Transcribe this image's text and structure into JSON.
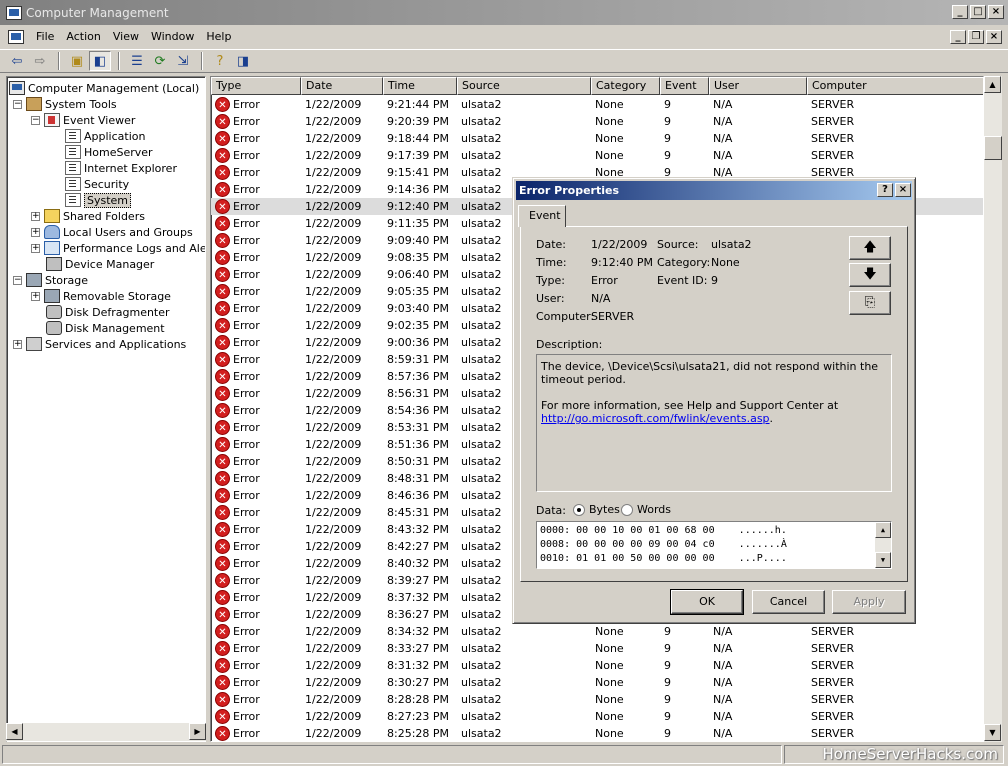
{
  "window": {
    "title": "Computer Management"
  },
  "menu": {
    "items": [
      "File",
      "Action",
      "View",
      "Window",
      "Help"
    ]
  },
  "tree": {
    "root": "Computer Management (Local)",
    "system_tools": "System Tools",
    "event_viewer": "Event Viewer",
    "logs": [
      "Application",
      "HomeServer",
      "Internet Explorer",
      "Security",
      "System"
    ],
    "shared_folders": "Shared Folders",
    "local_users": "Local Users and Groups",
    "perf_logs": "Performance Logs and Alerts",
    "device_manager": "Device Manager",
    "storage": "Storage",
    "removable": "Removable Storage",
    "defrag": "Disk Defragmenter",
    "disk_mgmt": "Disk Management",
    "services": "Services and Applications"
  },
  "list": {
    "columns": [
      "Type",
      "Date",
      "Time",
      "Source",
      "Category",
      "Event",
      "User",
      "Computer"
    ],
    "rows": [
      [
        "Error",
        "1/22/2009",
        "9:21:44 PM",
        "ulsata2",
        "None",
        "9",
        "N/A",
        "SERVER"
      ],
      [
        "Error",
        "1/22/2009",
        "9:20:39 PM",
        "ulsata2",
        "None",
        "9",
        "N/A",
        "SERVER"
      ],
      [
        "Error",
        "1/22/2009",
        "9:18:44 PM",
        "ulsata2",
        "None",
        "9",
        "N/A",
        "SERVER"
      ],
      [
        "Error",
        "1/22/2009",
        "9:17:39 PM",
        "ulsata2",
        "None",
        "9",
        "N/A",
        "SERVER"
      ],
      [
        "Error",
        "1/22/2009",
        "9:15:41 PM",
        "ulsata2",
        "None",
        "9",
        "N/A",
        "SERVER"
      ],
      [
        "Error",
        "1/22/2009",
        "9:14:36 PM",
        "ulsata2",
        "",
        "",
        "",
        ""
      ],
      [
        "Error",
        "1/22/2009",
        "9:12:40 PM",
        "ulsata2",
        "",
        "",
        "",
        ""
      ],
      [
        "Error",
        "1/22/2009",
        "9:11:35 PM",
        "ulsata2",
        "",
        "",
        "",
        ""
      ],
      [
        "Error",
        "1/22/2009",
        "9:09:40 PM",
        "ulsata2",
        "",
        "",
        "",
        ""
      ],
      [
        "Error",
        "1/22/2009",
        "9:08:35 PM",
        "ulsata2",
        "",
        "",
        "",
        ""
      ],
      [
        "Error",
        "1/22/2009",
        "9:06:40 PM",
        "ulsata2",
        "",
        "",
        "",
        ""
      ],
      [
        "Error",
        "1/22/2009",
        "9:05:35 PM",
        "ulsata2",
        "",
        "",
        "",
        ""
      ],
      [
        "Error",
        "1/22/2009",
        "9:03:40 PM",
        "ulsata2",
        "",
        "",
        "",
        ""
      ],
      [
        "Error",
        "1/22/2009",
        "9:02:35 PM",
        "ulsata2",
        "",
        "",
        "",
        ""
      ],
      [
        "Error",
        "1/22/2009",
        "9:00:36 PM",
        "ulsata2",
        "",
        "",
        "",
        ""
      ],
      [
        "Error",
        "1/22/2009",
        "8:59:31 PM",
        "ulsata2",
        "",
        "",
        "",
        ""
      ],
      [
        "Error",
        "1/22/2009",
        "8:57:36 PM",
        "ulsata2",
        "",
        "",
        "",
        ""
      ],
      [
        "Error",
        "1/22/2009",
        "8:56:31 PM",
        "ulsata2",
        "",
        "",
        "",
        ""
      ],
      [
        "Error",
        "1/22/2009",
        "8:54:36 PM",
        "ulsata2",
        "",
        "",
        "",
        ""
      ],
      [
        "Error",
        "1/22/2009",
        "8:53:31 PM",
        "ulsata2",
        "",
        "",
        "",
        ""
      ],
      [
        "Error",
        "1/22/2009",
        "8:51:36 PM",
        "ulsata2",
        "",
        "",
        "",
        ""
      ],
      [
        "Error",
        "1/22/2009",
        "8:50:31 PM",
        "ulsata2",
        "",
        "",
        "",
        ""
      ],
      [
        "Error",
        "1/22/2009",
        "8:48:31 PM",
        "ulsata2",
        "",
        "",
        "",
        ""
      ],
      [
        "Error",
        "1/22/2009",
        "8:46:36 PM",
        "ulsata2",
        "",
        "",
        "",
        ""
      ],
      [
        "Error",
        "1/22/2009",
        "8:45:31 PM",
        "ulsata2",
        "",
        "",
        "",
        ""
      ],
      [
        "Error",
        "1/22/2009",
        "8:43:32 PM",
        "ulsata2",
        "",
        "",
        "",
        ""
      ],
      [
        "Error",
        "1/22/2009",
        "8:42:27 PM",
        "ulsata2",
        "",
        "",
        "",
        ""
      ],
      [
        "Error",
        "1/22/2009",
        "8:40:32 PM",
        "ulsata2",
        "",
        "",
        "",
        ""
      ],
      [
        "Error",
        "1/22/2009",
        "8:39:27 PM",
        "ulsata2",
        "",
        "",
        "",
        ""
      ],
      [
        "Error",
        "1/22/2009",
        "8:37:32 PM",
        "ulsata2",
        "",
        "",
        "",
        ""
      ],
      [
        "Error",
        "1/22/2009",
        "8:36:27 PM",
        "ulsata2",
        "",
        "",
        "",
        ""
      ],
      [
        "Error",
        "1/22/2009",
        "8:34:32 PM",
        "ulsata2",
        "None",
        "9",
        "N/A",
        "SERVER"
      ],
      [
        "Error",
        "1/22/2009",
        "8:33:27 PM",
        "ulsata2",
        "None",
        "9",
        "N/A",
        "SERVER"
      ],
      [
        "Error",
        "1/22/2009",
        "8:31:32 PM",
        "ulsata2",
        "None",
        "9",
        "N/A",
        "SERVER"
      ],
      [
        "Error",
        "1/22/2009",
        "8:30:27 PM",
        "ulsata2",
        "None",
        "9",
        "N/A",
        "SERVER"
      ],
      [
        "Error",
        "1/22/2009",
        "8:28:28 PM",
        "ulsata2",
        "None",
        "9",
        "N/A",
        "SERVER"
      ],
      [
        "Error",
        "1/22/2009",
        "8:27:23 PM",
        "ulsata2",
        "None",
        "9",
        "N/A",
        "SERVER"
      ],
      [
        "Error",
        "1/22/2009",
        "8:25:28 PM",
        "ulsata2",
        "None",
        "9",
        "N/A",
        "SERVER"
      ]
    ]
  },
  "dialog": {
    "title": "Error Properties",
    "tab": "Event",
    "date_label": "Date:",
    "date": "1/22/2009",
    "source_label": "Source:",
    "source": "ulsata2",
    "time_label": "Time:",
    "time": "9:12:40 PM",
    "category_label": "Category:",
    "category": "None",
    "type_label": "Type:",
    "type": "Error",
    "eventid_label": "Event ID:",
    "eventid": "9",
    "user_label": "User:",
    "user": "N/A",
    "computer_label": "Computer:",
    "computer": "SERVER",
    "description_label": "Description:",
    "description_line1": "The device, \\Device\\Scsi\\ulsata21, did not respond within the timeout period.",
    "description_line2": "For more information, see Help and Support Center at",
    "description_link": "http://go.microsoft.com/fwlink/events.asp",
    "description_end": ".",
    "data_label": "Data:",
    "bytes_label": "Bytes",
    "words_label": "Words",
    "data_lines": [
      "0000: 00 00 10 00 01 00 68 00    ......h.",
      "0008: 00 00 00 00 09 00 04 c0    .......À",
      "0010: 01 01 00 50 00 00 00 00    ...P...."
    ],
    "ok": "OK",
    "cancel": "Cancel",
    "apply": "Apply"
  },
  "watermark": "HomeServerHacks.com"
}
